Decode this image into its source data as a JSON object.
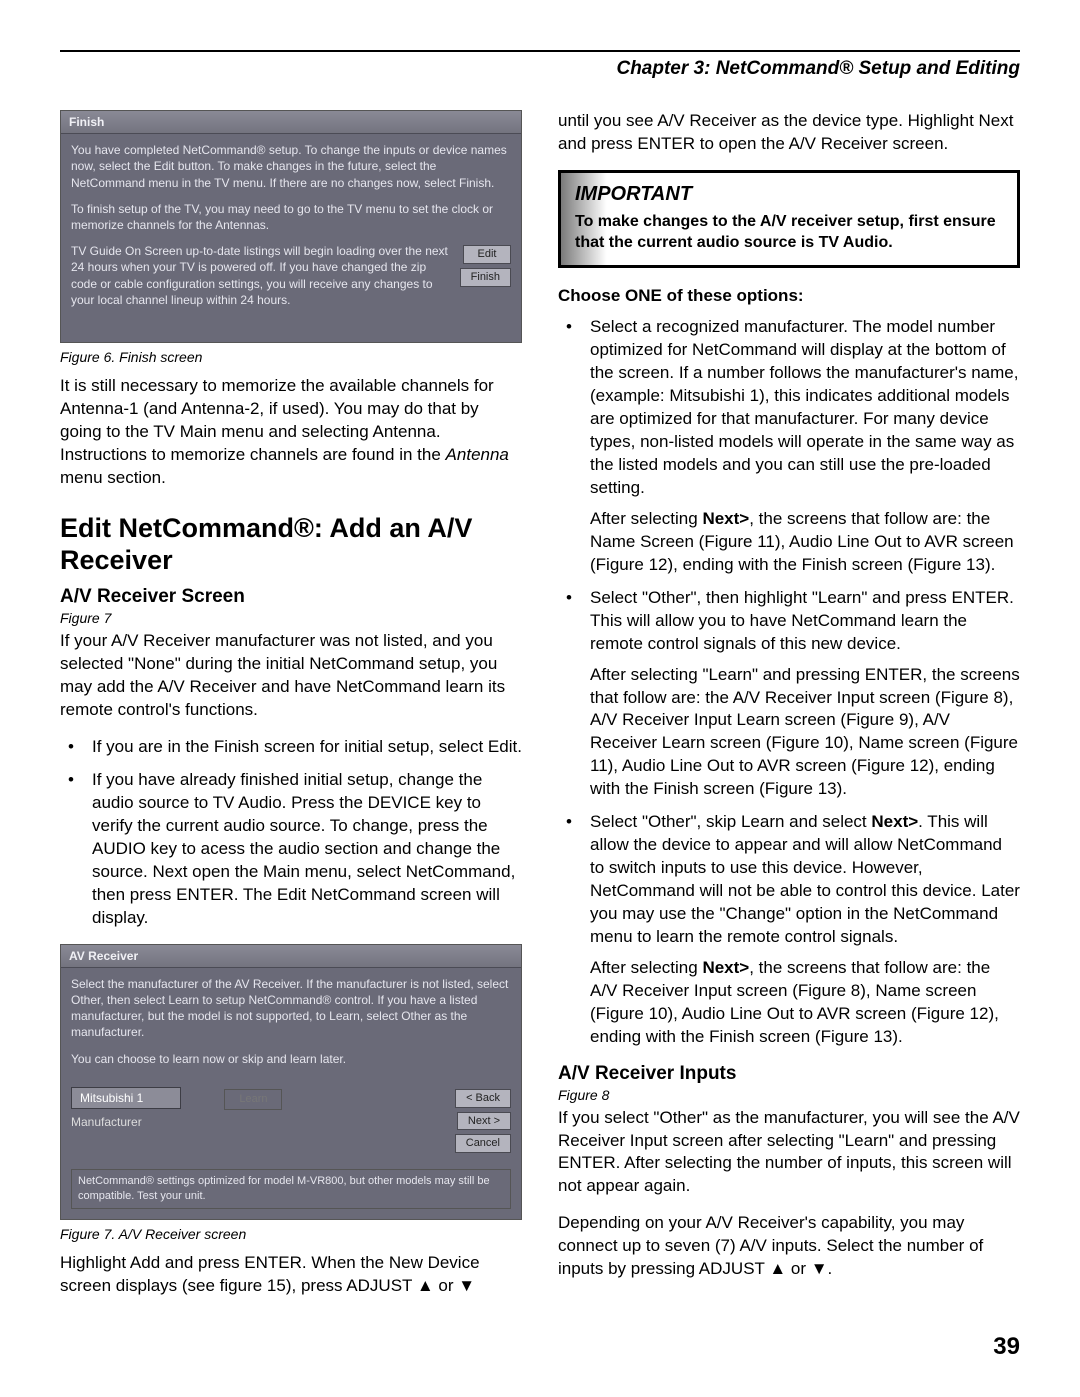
{
  "chapterTitle": "Chapter 3: NetCommand® Setup and Editing",
  "pageNumber": "39",
  "fig6": {
    "title": "Finish",
    "p1": "You have completed NetCommand® setup. To change the inputs or device names now, select the Edit button. To make changes in the future, select the NetCommand menu in the TV menu. If there are no changes now, select Finish.",
    "p2": "To finish setup of the TV, you may need to go to the TV menu to set the clock or memorize channels for the Antennas.",
    "p3": "TV Guide On Screen up-to-date listings will begin loading over the next 24 hours when your TV is powered off. If you have changed the zip code or cable configuration settings, you will receive any changes to your local channel lineup within 24 hours.",
    "btnEdit": "Edit",
    "btnFinish": "Finish",
    "caption": "Figure 6.  Finish screen"
  },
  "leftP1a": "It is still necessary to memorize the available channels for Antenna-1 (and Antenna-2, if used).  You may do that by going to the TV Main menu and selecting Antenna.  Instructions to memorize channels are found in the ",
  "leftP1b": "Antenna",
  "leftP1c": " menu section.",
  "h2": "Edit NetCommand®: Add an A/V Receiver",
  "h3a": "A/V Receiver Screen",
  "fig7ref": "Figure 7",
  "leftP2": "If your A/V Receiver manufacturer was not listed, and you selected \"None\" during the initial NetCommand setup, you may add the A/V Receiver and have NetCommand learn its remote control's functions.",
  "leftBullet1": "If you are in the Finish screen for initial setup, select Edit.",
  "leftBullet2": "If you have already finished initial setup, change the audio source to TV Audio.  Press the DEVICE key to verify the current audio source.  To change, press the AUDIO key to acess the audio section and change the source.  Next open the Main menu, select NetCommand, then press ENTER.  The Edit NetCommand screen will display.",
  "fig7": {
    "title": "AV Receiver",
    "p1": "Select the manufacturer of the AV Receiver.  If the manufacturer is not listed, select Other, then select Learn to setup NetCommand® control.  If you have a listed manufacturer, but the model is not supported, to Learn, select Other as the manufacturer.",
    "p2": "You can choose to learn now or skip and learn later.",
    "mfrValue": "Mitsubishi 1",
    "mfrLabel": "Manufacturer",
    "learn": "Learn",
    "btnBack": "< Back",
    "btnNext": "Next >",
    "btnCancel": "Cancel",
    "note": "NetCommand® settings optimized for model M-VR800, but other models may still be compatible. Test your unit.",
    "caption": "Figure 7.  A/V Receiver screen"
  },
  "leftP3": "Highlight Add and press ENTER.  When the New Device screen displays (see figure 15), press ADJUST ▲ or ▼",
  "rightTop": "until you see A/V Receiver as the device type.  Highlight Next and press ENTER to open the A/V Receiver screen.",
  "important": {
    "title": "IMPORTANT",
    "body": "To make changes to the A/V receiver setup, first ensure that the current audio source is TV Audio."
  },
  "chooseLine": "Choose ONE of these options:",
  "rb1": "Select a recognized manufacturer.  The model number optimized for NetCommand will display at the bottom of the screen. If a number follows the manufacturer's name, (example: Mitsubishi 1), this indicates additional models are optimized for that manufacturer.  For many device types, non-listed models will operate in the same way as the listed models and you can still use the pre-loaded setting.",
  "rb1after_a": "After selecting ",
  "rb1after_b": "Next>",
  "rb1after_c": ", the screens that follow are: the Name Screen (Figure 11), Audio Line Out to AVR screen (Figure 12), ending with the Finish screen (Figure 13).",
  "rb2": "Select \"Other\", then highlight \"Learn\" and press ENTER.  This will allow you to have NetCommand learn the remote control signals of this new device.",
  "rb2after": "After selecting \"Learn\" and pressing ENTER, the screens that follow are: the A/V Receiver Input screen (Figure 8), A/V Receiver Input Learn screen (Figure 9), A/V Receiver Learn screen (Figure 10), Name screen (Figure 11), Audio Line Out to AVR screen (Figure 12), ending with the Finish screen (Figure 13).",
  "rb3_a": "Select \"Other\", skip Learn and select ",
  "rb3_b": "Next>",
  "rb3_c": ".  This will allow the device to appear and will allow NetCommand to switch inputs to use this device.  However, NetCommand will not be able to control this device.  Later you may use the \"Change\" option in the NetCommand menu to learn the remote control signals.",
  "rb3after_a": "After selecting ",
  "rb3after_b": "Next>",
  "rb3after_c": ", the screens that follow are: the A/V Receiver Input screen (Figure 8), Name screen (Figure 10), Audio Line Out to AVR screen (Figure 12), ending with the Finish screen (Figure 13).",
  "h3b": "A/V Receiver Inputs",
  "fig8ref": "Figure 8",
  "rightP2": "If  you select \"Other\" as the manufacturer, you will see the A/V Receiver Input screen after selecting \"Learn\" and pressing ENTER.  After selecting the number of inputs, this screen will not appear again.",
  "rightP3": "Depending on your A/V Receiver's capability, you may connect up to seven (7) A/V inputs.  Select the  number of inputs by pressing  ADJUST ▲ or  ▼."
}
